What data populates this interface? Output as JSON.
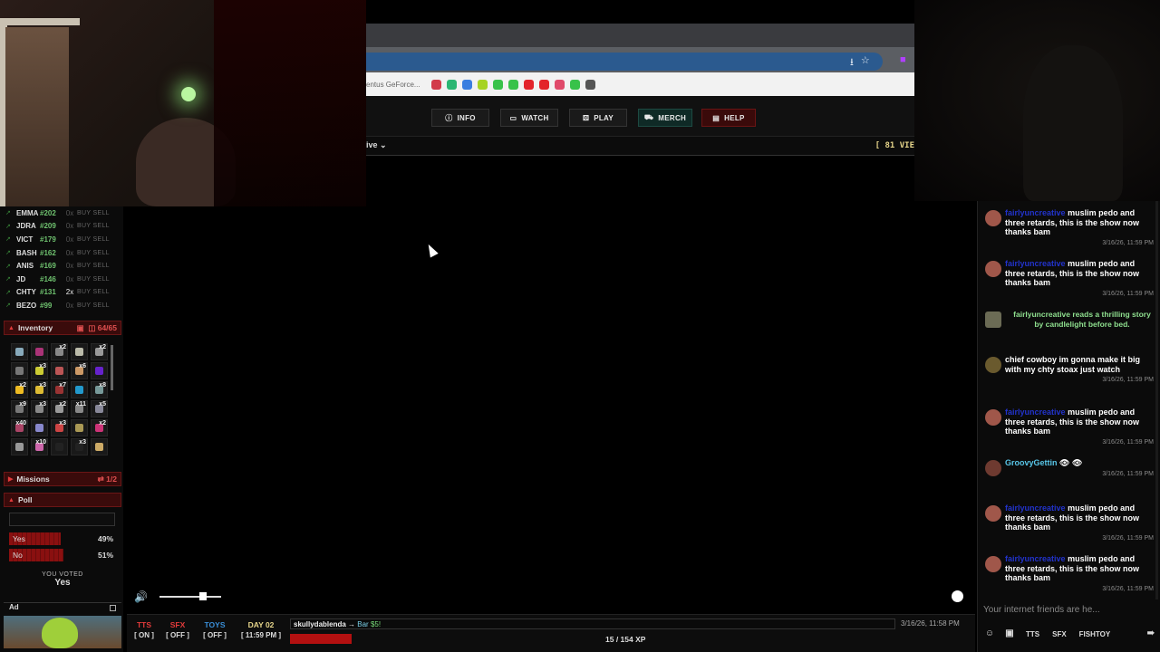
{
  "browser": {
    "bookmark_text": "entus GeForce...",
    "url_icons": [
      "⭳",
      "☆"
    ],
    "nav": {
      "info": "INFO",
      "watch": "WATCH",
      "play": "PLAY",
      "merch": "MERCH",
      "help": "HELP"
    },
    "live_select": "ive",
    "view_count": "[ 81 VIE"
  },
  "stocks": [
    {
      "ticker": "EMMA",
      "price": "#202",
      "qty": "0x",
      "buy": "BUY",
      "sell": "SELL"
    },
    {
      "ticker": "JDRA",
      "price": "#209",
      "qty": "0x",
      "buy": "BUY",
      "sell": "SELL"
    },
    {
      "ticker": "VICT",
      "price": "#179",
      "qty": "0x",
      "buy": "BUY",
      "sell": "SELL"
    },
    {
      "ticker": "BASH",
      "price": "#162",
      "qty": "0x",
      "buy": "BUY",
      "sell": "SELL"
    },
    {
      "ticker": "ANIS",
      "price": "#169",
      "qty": "0x",
      "buy": "BUY",
      "sell": "SELL"
    },
    {
      "ticker": "JD",
      "price": "#146",
      "qty": "0x",
      "buy": "BUY",
      "sell": "SELL"
    },
    {
      "ticker": "CHTY",
      "price": "#131",
      "qty": "2x",
      "buy": "BUY",
      "sell": "SELL"
    },
    {
      "ticker": "BEZO",
      "price": "#99",
      "qty": "0x",
      "buy": "BUY",
      "sell": "SELL"
    }
  ],
  "inventory": {
    "title": "Inventory",
    "count": "64/65",
    "slots": [
      {
        "c": "",
        "col": "#8ab"
      },
      {
        "c": "",
        "col": "#a37"
      },
      {
        "c": "x2",
        "col": "#888"
      },
      {
        "c": "",
        "col": "#bba"
      },
      {
        "c": "x2",
        "col": "#999"
      },
      {
        "c": "",
        "col": "#777"
      },
      {
        "c": "x3",
        "col": "#cc3"
      },
      {
        "c": "",
        "col": "#b55"
      },
      {
        "c": "x6",
        "col": "#c96"
      },
      {
        "c": "",
        "col": "#62c"
      },
      {
        "c": "x2",
        "col": "#eb2"
      },
      {
        "c": "x3",
        "col": "#db3"
      },
      {
        "c": "x7",
        "col": "#933"
      },
      {
        "c": "",
        "col": "#29c"
      },
      {
        "c": "x8",
        "col": "#799"
      },
      {
        "c": "x9",
        "col": "#777"
      },
      {
        "c": "x3",
        "col": "#888"
      },
      {
        "c": "x2",
        "col": "#999"
      },
      {
        "c": "x11",
        "col": "#888"
      },
      {
        "c": "x5",
        "col": "#889"
      },
      {
        "c": "x40",
        "col": "#a46"
      },
      {
        "c": "",
        "col": "#88c"
      },
      {
        "c": "x3",
        "col": "#c44"
      },
      {
        "c": "",
        "col": "#a95"
      },
      {
        "c": "x2",
        "col": "#c37"
      },
      {
        "c": "",
        "col": "#999"
      },
      {
        "c": "x10",
        "col": "#c6a"
      },
      {
        "c": "",
        "col": "#222"
      },
      {
        "c": "x3",
        "col": "#222"
      },
      {
        "c": "",
        "col": "#ca6"
      }
    ]
  },
  "missions": {
    "title": "Missions",
    "count": "1/2"
  },
  "poll": {
    "title": "Poll",
    "options": [
      {
        "label": "Yes",
        "pct": "49%",
        "value": 0.49
      },
      {
        "label": "No",
        "pct": "51%",
        "value": 0.51
      }
    ],
    "voted_label": "YOU VOTED",
    "voted_value": "Yes"
  },
  "ad": {
    "title": "Ad"
  },
  "player": {
    "volume": 0.7
  },
  "status": {
    "tts": {
      "label": "TTS",
      "state": "[ ON ]",
      "color": "#e23b3b"
    },
    "sfx": {
      "label": "SFX",
      "state": "[ OFF ]",
      "color": "#e23b3b"
    },
    "toys": {
      "label": "TOYS",
      "state": "[ OFF ]",
      "color": "#3a8fd8"
    },
    "day": {
      "label": "DAY 02",
      "state": "[ 11:59 PM ]",
      "color": "#e6d58a"
    },
    "chat_user": "skullydablenda",
    "chat_arrow": "→",
    "chat_target": "Bar",
    "chat_amount": "$5!",
    "timestamp": "3/16/26, 11:58 PM",
    "xp_text": "15 / 154 XP",
    "xp_fraction": 0.097
  },
  "chat": {
    "messages": [
      {
        "type": "msg",
        "name": "fairlyuncreative",
        "name_color": "#2233cc",
        "text": "muslim pedo and three retards, this is the show now thanks bam",
        "time": "3/16/26, 11:59 PM",
        "av": "#a0574a"
      },
      {
        "type": "msg",
        "name": "fairlyuncreative",
        "name_color": "#2233cc",
        "text": "muslim pedo and three retards, this is the show now thanks bam",
        "time": "3/16/26, 11:59 PM",
        "av": "#a0574a"
      },
      {
        "type": "event",
        "text": "fairlyuncreative reads a thrilling story by candlelight before bed."
      },
      {
        "type": "msg",
        "name": "chief cowboy",
        "name_color": "#ffffff",
        "text": "im gonna make it big with my chty stoax just watch",
        "time": "3/16/26, 11:59 PM",
        "av": "#6a5a2e"
      },
      {
        "type": "msg",
        "name": "fairlyuncreative",
        "name_color": "#2233cc",
        "text": "muslim pedo and three retards, this is the show now thanks bam",
        "time": "3/16/26, 11:59 PM",
        "av": "#a0574a"
      },
      {
        "type": "msg",
        "name": "GroovyGettin",
        "name_color": "#58c6e8",
        "text": "👁 👁",
        "time": "3/16/26, 11:59 PM",
        "av": "#6e3a30"
      },
      {
        "type": "msg",
        "name": "fairlyuncreative",
        "name_color": "#2233cc",
        "text": "muslim pedo and three retards, this is the show now thanks bam",
        "time": "3/16/26, 11:59 PM",
        "av": "#a0574a"
      },
      {
        "type": "msg",
        "name": "fairlyuncreative",
        "name_color": "#2233cc",
        "text": "muslim pedo and three retards, this is the show now thanks bam",
        "time": "3/16/26, 11:59 PM",
        "av": "#a0574a"
      }
    ],
    "input_placeholder": "Your internet friends are he...",
    "tools": {
      "tts": "TTS",
      "sfx": "SFX",
      "fishtoy": "FISHTOY"
    }
  }
}
